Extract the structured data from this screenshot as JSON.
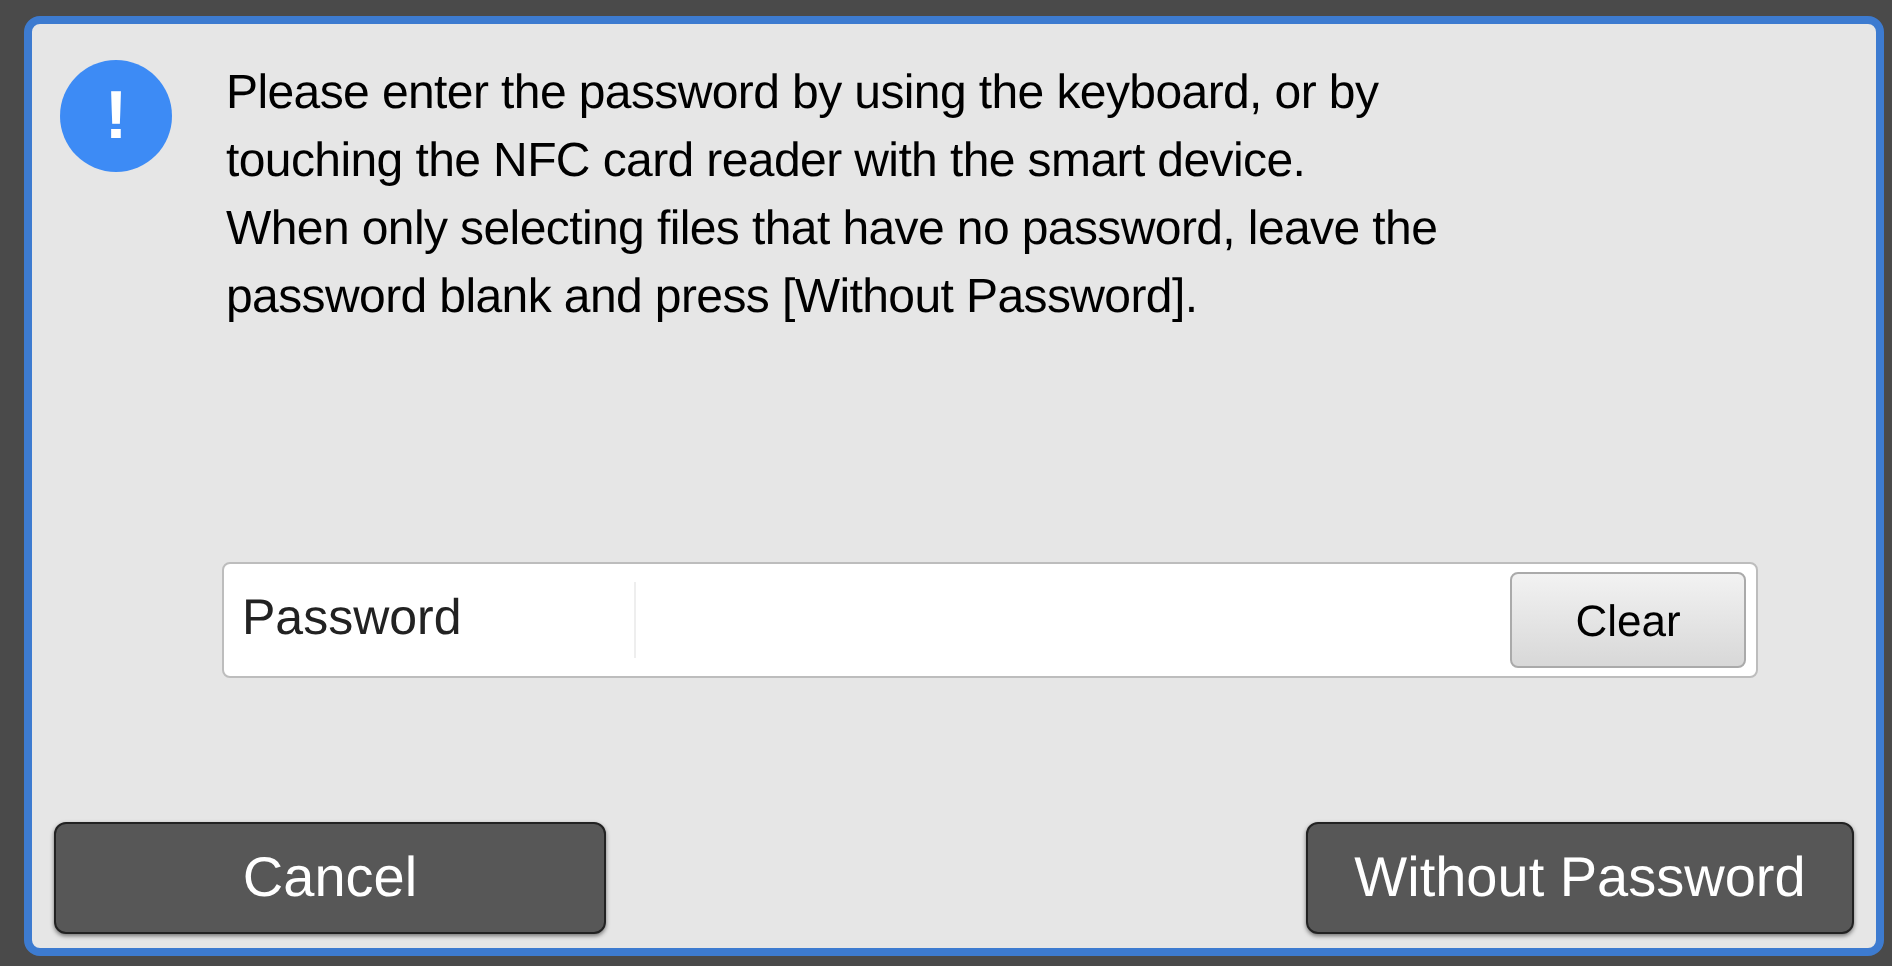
{
  "dialog": {
    "message_lines": [
      "Please enter the password by using the keyboard, or by",
      "touching the NFC card reader with the smart device.",
      "When only selecting files that have no password, leave the",
      "password blank and press [Without Password]."
    ],
    "icon_glyph": "!",
    "password_field": {
      "label": "Password"
    },
    "clear_button": "Clear",
    "buttons": [
      {
        "label": "Cancel"
      },
      {
        "label": "Without Password"
      }
    ]
  }
}
